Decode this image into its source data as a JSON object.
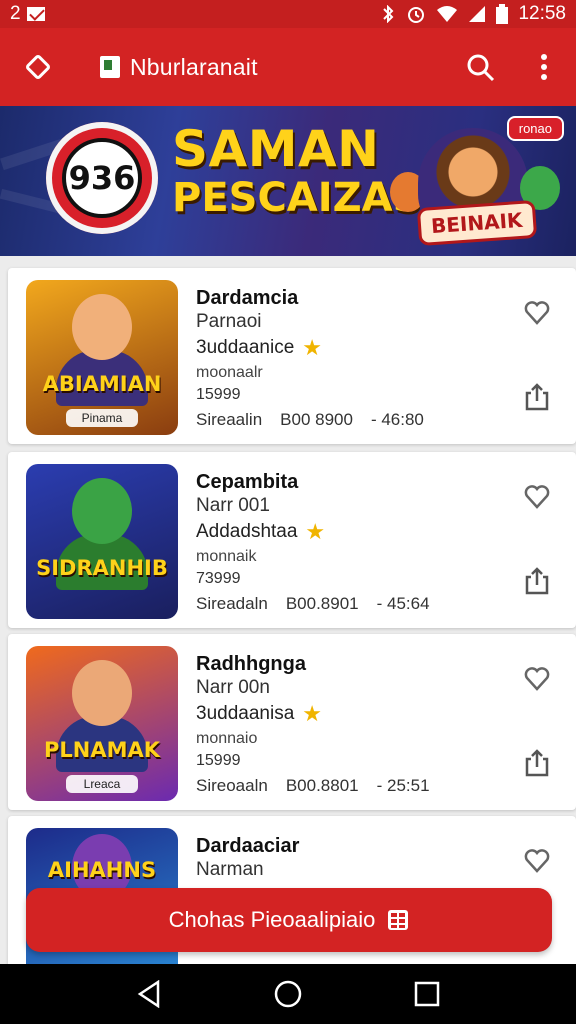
{
  "status_bar": {
    "left_text": "2",
    "time": "12:58"
  },
  "app_bar": {
    "title": "Nburlaranait",
    "icons": [
      "diamond-menu-icon",
      "app-logo-icon",
      "search-icon",
      "more-vert-icon"
    ]
  },
  "banner": {
    "badge_text": "936",
    "headline_line1": "SAMAN",
    "headline_line2": "PESCAIZAS",
    "tag_text": "ronao",
    "character_tag": "BEINAIK"
  },
  "games": [
    {
      "name": "Dardamcia",
      "author": "Parnaoi",
      "rating_label": "3uddaanice",
      "category": "moonaalr",
      "count": "15999",
      "size": "Sireaalin",
      "downloads": "B00 8900",
      "time": "46:80",
      "thumb_title": "ABIAMIAN",
      "thumb_sub": "Pinama",
      "thumb_colors": {
        "bg1": "#f2a81d",
        "bg2": "#8a3d10",
        "face": "#f1b07a",
        "body": "#3b2f7a"
      }
    },
    {
      "name": "Cepambita",
      "author": "Narr 001",
      "rating_label": "Addadshtaa",
      "category": "monnaik",
      "count": "73999",
      "size": "Sireadaln",
      "downloads": "B00.8901",
      "time": "45:64",
      "thumb_title": "SIDRANHIB",
      "thumb_sub": "",
      "thumb_colors": {
        "bg1": "#2b3db0",
        "bg2": "#1a1f5e",
        "face": "#3aa345",
        "body": "#2b7d2e"
      }
    },
    {
      "name": "Radhhgnga",
      "author": "Narr 00n",
      "rating_label": "3uddaanisa",
      "category": "monnaio",
      "count": "15999",
      "size": "Sireoaaln",
      "downloads": "B00.8801",
      "time": "25:51",
      "thumb_title": "PLNAMAK",
      "thumb_sub": "Lreaca",
      "thumb_colors": {
        "bg1": "#f06a1c",
        "bg2": "#6b2ab0",
        "face": "#eba877",
        "body": "#2b3580"
      }
    },
    {
      "name": "Dardaaciar",
      "author": "Narman",
      "rating_label": "",
      "category": "",
      "count": "",
      "size": "",
      "downloads": "",
      "time": "",
      "thumb_title": "AIHAHNS",
      "thumb_sub": "",
      "thumb_colors": {
        "bg1": "#1d2b8a",
        "bg2": "#2a8ad6",
        "face": "#7a3db0",
        "body": "#2a5090"
      }
    }
  ],
  "cta": {
    "label": "Chohas Pieoaalipiaio"
  },
  "colors": {
    "primary": "#d32323",
    "star": "#f0b400"
  }
}
